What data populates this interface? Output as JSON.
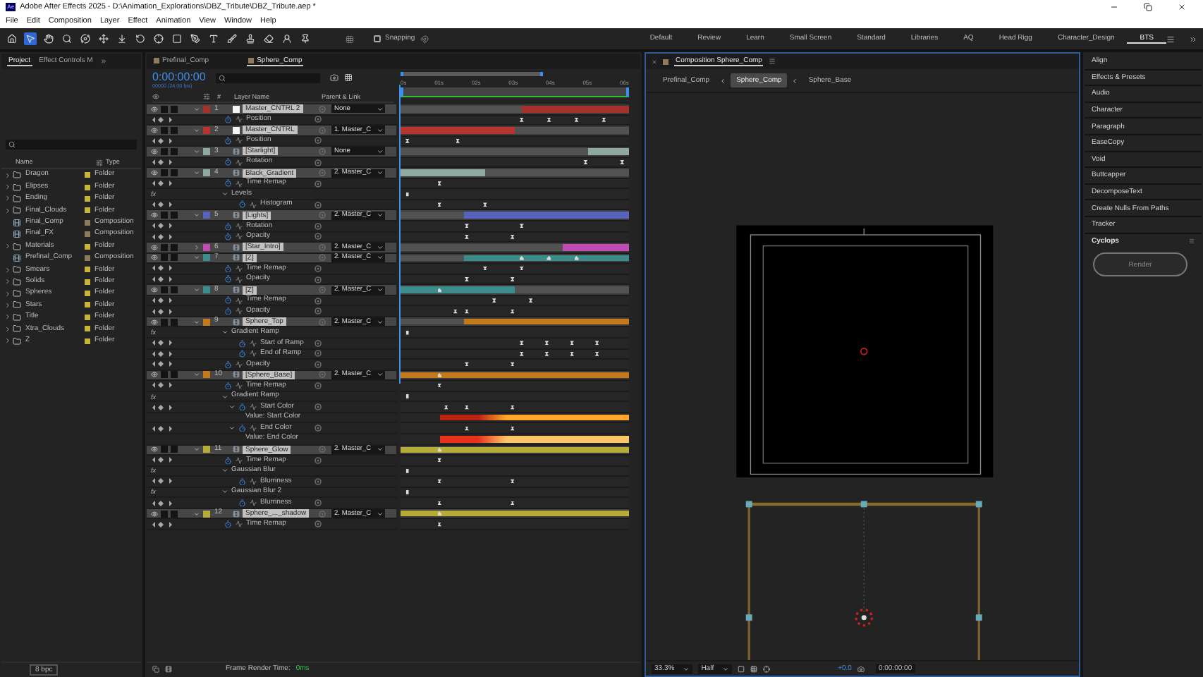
{
  "window": {
    "title": "Adobe After Effects 2025 - D:\\Animation_Explorations\\DBZ_Tribute\\DBZ_Tribute.aep *",
    "app_badge": "Ae"
  },
  "menu": [
    "File",
    "Edit",
    "Composition",
    "Layer",
    "Effect",
    "Animation",
    "View",
    "Window",
    "Help"
  ],
  "toolbar": {
    "tools": [
      {
        "kind": "home",
        "selected": false
      },
      {
        "kind": "selection",
        "selected": true
      },
      {
        "kind": "hand",
        "selected": false
      },
      {
        "kind": "zoom",
        "selected": false
      },
      {
        "kind": "orbit",
        "selected": false
      },
      {
        "kind": "move",
        "selected": false
      },
      {
        "kind": "pan",
        "selected": false
      },
      {
        "kind": "rotate",
        "selected": false
      },
      {
        "kind": "anchor",
        "selected": false
      },
      {
        "kind": "rectangle",
        "selected": false
      },
      {
        "kind": "pen",
        "selected": false
      },
      {
        "kind": "type",
        "selected": false
      },
      {
        "kind": "brush",
        "selected": false
      },
      {
        "kind": "clone",
        "selected": false
      },
      {
        "kind": "eraser",
        "selected": false
      },
      {
        "kind": "roto",
        "selected": false
      },
      {
        "kind": "puppet",
        "selected": false
      }
    ],
    "snapping": {
      "label": "Snapping",
      "checked": false
    }
  },
  "workspaces": [
    {
      "label": "Default",
      "selected": false
    },
    {
      "label": "Review",
      "selected": false
    },
    {
      "label": "Learn",
      "selected": false
    },
    {
      "label": "Small Screen",
      "selected": false
    },
    {
      "label": "Standard",
      "selected": false
    },
    {
      "label": "Libraries",
      "selected": false
    },
    {
      "label": "AQ",
      "selected": false
    },
    {
      "label": "Head Rigg",
      "selected": false
    },
    {
      "label": "Character_Design",
      "selected": false
    },
    {
      "label": "BTS",
      "selected": true
    }
  ],
  "project": {
    "tabs": [
      {
        "label": "Project",
        "selected": true
      },
      {
        "label": "Effect Controls M",
        "selected": false
      }
    ],
    "columns": [
      "Name",
      "Type"
    ],
    "items": [
      {
        "name": "Dragon",
        "kind": "folder",
        "type": "Folder",
        "color": "#c8b43a"
      },
      {
        "name": "Elipses",
        "kind": "folder",
        "type": "Folder",
        "color": "#c8b43a"
      },
      {
        "name": "Ending",
        "kind": "folder",
        "type": "Folder",
        "color": "#c8b43a"
      },
      {
        "name": "Final_Clouds",
        "kind": "folder",
        "type": "Folder",
        "color": "#c8b43a"
      },
      {
        "name": "Final_Comp",
        "kind": "composition",
        "type": "Composition",
        "color": "#8c7c5c"
      },
      {
        "name": "Final_FX",
        "kind": "composition",
        "type": "Composition",
        "color": "#8c7c5c"
      },
      {
        "name": "Materials",
        "kind": "folder",
        "type": "Folder",
        "color": "#c8b43a"
      },
      {
        "name": "Prefinal_Comp",
        "kind": "composition",
        "type": "Composition",
        "color": "#8c7c5c"
      },
      {
        "name": "Smears",
        "kind": "folder",
        "type": "Folder",
        "color": "#c8b43a"
      },
      {
        "name": "Solids",
        "kind": "folder",
        "type": "Folder",
        "color": "#c8b43a"
      },
      {
        "name": "Spheres",
        "kind": "folder",
        "type": "Folder",
        "color": "#c8b43a"
      },
      {
        "name": "Stars",
        "kind": "folder",
        "type": "Folder",
        "color": "#c8b43a"
      },
      {
        "name": "Title",
        "kind": "folder",
        "type": "Folder",
        "color": "#c8b43a"
      },
      {
        "name": "Xtra_Clouds",
        "kind": "folder",
        "type": "Folder",
        "color": "#c8b43a"
      },
      {
        "name": "Z",
        "kind": "folder",
        "type": "Folder",
        "color": "#c8b43a"
      }
    ],
    "bit_depth": "8 bpc"
  },
  "timeline": {
    "tabs": [
      {
        "label": "Prefinal_Comp",
        "selected": false
      },
      {
        "label": "Sphere_Comp",
        "selected": true
      }
    ],
    "timecode": "0:00:00:00",
    "frame_info": "00000 (24.00 fps)",
    "columns": [
      "#",
      "Layer Name",
      "Parent & Link"
    ],
    "ruler": [
      "0s",
      "01s",
      "02s",
      "03s",
      "04s",
      "05s",
      "06s"
    ],
    "layers": [
      {
        "number": "1",
        "name": "Master_CNTRL 2",
        "kind": "solid",
        "color": "#a8302c",
        "expanded": true,
        "parent": "None",
        "track": {
          "kind": "tail",
          "level": 0.47
        },
        "children": [
          {
            "kind": "property",
            "name": "Position",
            "keyframes": [
              {
                "level": 0.53
              },
              {
                "level": 0.65
              },
              {
                "level": 0.77
              },
              {
                "level": 0.89
              }
            ]
          }
        ]
      },
      {
        "number": "2",
        "name": "Master_CNTRL",
        "kind": "solid",
        "color": "#b8342e",
        "expanded": true,
        "parent": "1. Master_C",
        "track": {
          "kind": "head",
          "level": 0.5
        },
        "children": [
          {
            "kind": "property",
            "name": "Position",
            "keyframes": [
              {
                "level": 0.03
              },
              {
                "level": 0.25
              }
            ]
          }
        ]
      },
      {
        "number": "3",
        "name": "[Starlight]",
        "kind": "comp",
        "color": "#8fa8a0",
        "expanded": true,
        "parent": "None",
        "track": {
          "kind": "tail",
          "level": 0.18
        },
        "children": [
          {
            "kind": "property",
            "name": "Rotation",
            "keyframes": [
              {
                "level": 0.81
              },
              {
                "level": 0.97
              }
            ]
          }
        ]
      },
      {
        "number": "4",
        "name": "Black_Gradient",
        "kind": "comp",
        "color": "#8fa8a0",
        "expanded": true,
        "parent": "2. Master_C",
        "track": {
          "kind": "head",
          "level": 0.37
        },
        "children": [
          {
            "kind": "property",
            "name": "Time Remap",
            "keyframes": [
              {
                "level": 0.17
              }
            ]
          },
          {
            "kind": "effect",
            "badge": "fx",
            "name": "Levels",
            "expanded": true,
            "keyframes": [
              {
                "level": 0.03
              }
            ],
            "children": [
              {
                "kind": "property",
                "name": "Histogram",
                "keyframes": [
                  {
                    "level": 0.17
                  },
                  {
                    "level": 0.37
                  }
                ]
              }
            ]
          }
        ]
      },
      {
        "number": "5",
        "name": "[Lights]",
        "kind": "comp",
        "color": "#5864bc",
        "expanded": true,
        "parent": "2. Master_C",
        "track": {
          "kind": "tail",
          "level": 0.72
        },
        "children": [
          {
            "kind": "property",
            "name": "Rotation",
            "keyframes": [
              {
                "level": 0.29
              },
              {
                "level": 0.53
              }
            ]
          },
          {
            "kind": "property",
            "name": "Opacity",
            "keyframes": [
              {
                "level": 0.29
              },
              {
                "level": 0.49
              }
            ]
          }
        ]
      },
      {
        "number": "6",
        "name": "[Star_Intro]",
        "kind": "comp",
        "color": "#c04cb4",
        "expanded": false,
        "parent": "2. Master_C",
        "track": {
          "kind": "tail",
          "level": 0.29
        }
      },
      {
        "number": "7",
        "name": "[Z]",
        "kind": "comp",
        "color": "#3c8c8c",
        "expanded": true,
        "parent": "2. Master_C",
        "track": {
          "kind": "tail",
          "level": 0.72
        },
        "keyframes": [
          {
            "level": 0.53
          },
          {
            "level": 0.65
          },
          {
            "level": 0.77
          }
        ],
        "children": [
          {
            "kind": "property",
            "name": "Time Remap",
            "keyframes": [
              {
                "level": 0.37
              },
              {
                "level": 0.53
              }
            ]
          },
          {
            "kind": "property",
            "name": "Opacity",
            "keyframes": [
              {
                "level": 0.29
              },
              {
                "level": 0.49
              }
            ]
          }
        ]
      },
      {
        "number": "8",
        "name": "[Z]",
        "kind": "comp",
        "color": "#3c8c8c",
        "expanded": true,
        "parent": "2. Master_C",
        "track": {
          "kind": "head",
          "level": 0.5
        },
        "keyframes": [
          {
            "level": 0.17
          }
        ],
        "children": [
          {
            "kind": "property",
            "name": "Time Remap",
            "keyframes": [
              {
                "level": 0.41
              },
              {
                "level": 0.57
              }
            ]
          },
          {
            "kind": "property",
            "name": "Opacity",
            "keyframes": [
              {
                "level": 0.24
              },
              {
                "level": 0.29
              },
              {
                "level": 0.49
              }
            ]
          }
        ]
      },
      {
        "number": "9",
        "name": "Sphere_Top",
        "kind": "comp",
        "color": "#c47a1c",
        "expanded": true,
        "parent": "2. Master_C",
        "track": {
          "kind": "tail",
          "level": 0.72
        },
        "children": [
          {
            "kind": "effect",
            "badge": "fx",
            "name": "Gradient Ramp",
            "expanded": true,
            "keyframes": [
              {
                "level": 0.03
              }
            ],
            "children": [
              {
                "kind": "property",
                "name": "Start of Ramp",
                "keyframes": [
                  {
                    "level": 0.53
                  },
                  {
                    "level": 0.64
                  },
                  {
                    "level": 0.75
                  },
                  {
                    "level": 0.86
                  }
                ]
              },
              {
                "kind": "property",
                "name": "End of Ramp",
                "keyframes": [
                  {
                    "level": 0.53
                  },
                  {
                    "level": 0.64
                  },
                  {
                    "level": 0.75
                  },
                  {
                    "level": 0.86
                  }
                ]
              }
            ]
          },
          {
            "kind": "property",
            "name": "Opacity",
            "keyframes": [
              {
                "level": 0.29
              },
              {
                "level": 0.49
              }
            ]
          }
        ]
      },
      {
        "number": "10",
        "name": "[Sphere_Base]",
        "kind": "comp",
        "color": "#c47a1c",
        "expanded": true,
        "parent": "2. Master_C",
        "track": {
          "kind": "head",
          "level": 1
        },
        "keyframes": [
          {
            "level": 0.17
          }
        ],
        "children": [
          {
            "kind": "property",
            "name": "Time Remap",
            "keyframes": [
              {
                "level": 0.17
              }
            ]
          },
          {
            "kind": "effect",
            "badge": "fx",
            "name": "Gradient Ramp",
            "expanded": true,
            "keyframes": [
              {
                "level": 0.03
              }
            ],
            "children": [
              {
                "kind": "property",
                "name": "Start Color",
                "expanded": true,
                "keyframes": [
                  {
                    "level": 0.2
                  },
                  {
                    "level": 0.29
                  },
                  {
                    "level": 0.49
                  }
                ],
                "children": [
                  {
                    "kind": "value",
                    "name": "Value: Start Color",
                    "track": {
                      "kind": "tail",
                      "level": 0.83
                    },
                    "stops": [
                      {
                        "color": "#b8200f"
                      },
                      {
                        "color": "#ffa62a"
                      }
                    ]
                  }
                ]
              },
              {
                "kind": "property",
                "name": "End Color",
                "expanded": true,
                "keyframes": [
                  {
                    "level": 0.29
                  },
                  {
                    "level": 0.49
                  }
                ],
                "children": [
                  {
                    "kind": "value",
                    "name": "Value: End Color",
                    "track": {
                      "kind": "tail",
                      "level": 0.83
                    },
                    "stops": [
                      {
                        "color": "#e8301c"
                      },
                      {
                        "color": "#ffc468"
                      }
                    ]
                  }
                ]
              }
            ]
          }
        ]
      },
      {
        "number": "11",
        "name": "Sphere_Glow",
        "kind": "comp",
        "color": "#b8ac38",
        "expanded": true,
        "parent": "2. Master_C",
        "track": {
          "kind": "head",
          "level": 1
        },
        "keyframes": [
          {
            "level": 0.17
          }
        ],
        "children": [
          {
            "kind": "property",
            "name": "Time Remap",
            "keyframes": [
              {
                "level": 0.17
              }
            ]
          },
          {
            "kind": "effect",
            "badge": "fx",
            "name": "Gaussian Blur",
            "expanded": true,
            "keyframes": [
              {
                "level": 0.03
              }
            ],
            "children": [
              {
                "kind": "property",
                "name": "Blurriness",
                "keyframes": [
                  {
                    "level": 0.17
                  },
                  {
                    "level": 0.49
                  }
                ]
              }
            ]
          },
          {
            "kind": "effect",
            "badge": "fx",
            "name": "Gaussian Blur 2",
            "expanded": true,
            "keyframes": [
              {
                "level": 0.03
              }
            ],
            "children": [
              {
                "kind": "property",
                "name": "Blurriness",
                "keyframes": [
                  {
                    "level": 0.17
                  },
                  {
                    "level": 0.49
                  }
                ]
              }
            ]
          }
        ]
      },
      {
        "number": "12",
        "name": "Sphere_..._shadow",
        "kind": "comp",
        "color": "#b8ac38",
        "expanded": true,
        "parent": "2. Master_C",
        "track": {
          "kind": "head",
          "level": 1
        },
        "keyframes": [
          {
            "level": 0.17
          }
        ],
        "children": [
          {
            "kind": "property",
            "name": "Time Remap",
            "keyframes": [
              {
                "level": 0.17
              }
            ]
          }
        ]
      }
    ],
    "footer_label": "Frame Render Time:",
    "render_time": "0ms"
  },
  "composition": {
    "tab": "Composition Sphere_Comp",
    "breadcrumbs": [
      {
        "label": "Prefinal_Comp",
        "selected": false
      },
      {
        "label": "Sphere_Comp",
        "selected": true
      },
      {
        "label": "Sphere_Base",
        "selected": false
      }
    ],
    "zoom": "33.3%",
    "resolution": "Half",
    "exposure": "+0.0",
    "timecode": "0:00:00:00"
  },
  "panels": {
    "items": [
      "Align",
      "Effects & Presets",
      "Audio",
      "Character",
      "Paragraph",
      "EaseCopy",
      "Void",
      "Buttcapper",
      "DecomposeText",
      "Create Nulls From Paths",
      "Tracker"
    ],
    "active": {
      "title": "Cyclops",
      "button": "Render"
    }
  }
}
